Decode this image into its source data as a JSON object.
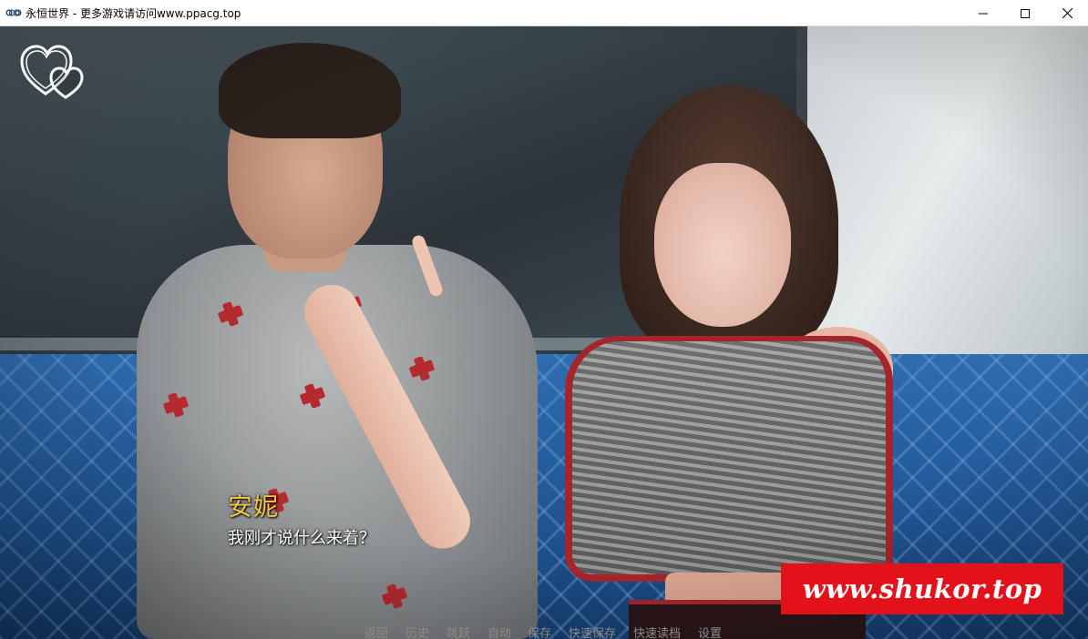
{
  "window": {
    "title": "永恒世界 - 更多游戏请访问www.ppacg.top",
    "app_icon": "infinity-icon",
    "controls": [
      "minimize-icon",
      "maximize-icon",
      "close-icon"
    ]
  },
  "scene": {
    "affection_icon": "hearts-icon"
  },
  "dialogue": {
    "speaker": "安妮",
    "speaker_color": "#f6c84a",
    "text": "我刚才说什么来着？"
  },
  "quick_menu": {
    "items": [
      "返回",
      "历史",
      "跳跃",
      "自动",
      "保存",
      "快速保存",
      "快速读档",
      "设置"
    ],
    "color": "#8b8b8b"
  },
  "watermark": {
    "text": "www.shukor.top",
    "bg_color": "#e3111a"
  }
}
